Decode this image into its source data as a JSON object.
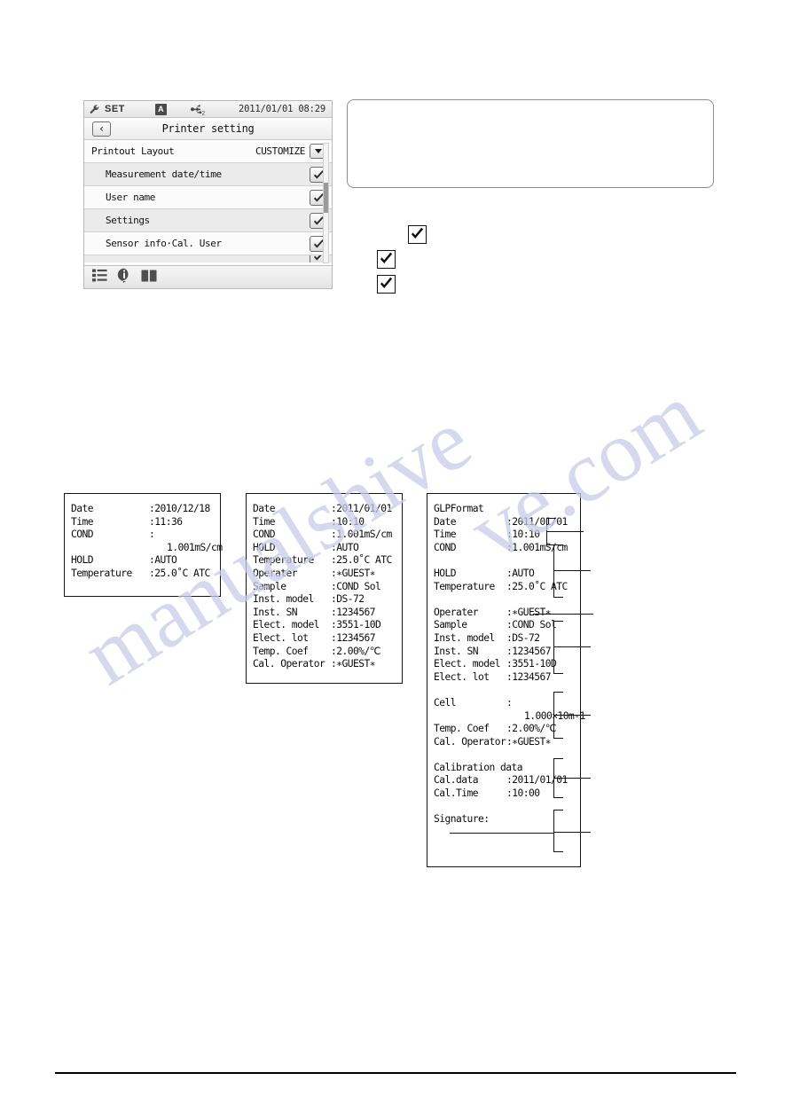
{
  "device": {
    "status_bar": {
      "mode_label": "SET",
      "wrench_icon": "wrench-icon",
      "a_badge": "A",
      "usb_icon": "usb-icon",
      "usb_subscript": "2",
      "datetime": "2011/01/01 08:29"
    },
    "title_bar": {
      "back_label": "‹",
      "title": "Printer setting"
    },
    "rows": [
      {
        "label": "Printout Layout",
        "value": "CUSTOMIZE",
        "control": "dropdown",
        "level": 0
      },
      {
        "label": "Measurement date/time",
        "value": "",
        "control": "checkbox",
        "checked": true,
        "level": 1
      },
      {
        "label": "User name",
        "value": "",
        "control": "checkbox",
        "checked": true,
        "level": 1
      },
      {
        "label": "Settings",
        "value": "",
        "control": "checkbox",
        "checked": true,
        "level": 1
      },
      {
        "label": "Sensor info·Cal. User",
        "value": "",
        "control": "checkbox",
        "checked": true,
        "level": 1
      }
    ],
    "toolbar": [
      {
        "icon": "list-icon"
      },
      {
        "icon": "info-icon"
      },
      {
        "icon": "book-icon"
      }
    ]
  },
  "callout": {
    "text": ""
  },
  "floating_checkboxes": [
    {
      "name": "checkmark-icon-1",
      "checked": true
    },
    {
      "name": "checkmark-icon-2",
      "checked": true
    },
    {
      "name": "checkmark-icon-3",
      "checked": true
    }
  ],
  "printouts": [
    {
      "id": "printout-standard",
      "lines": [
        {
          "key": "Date",
          "value": ":2010/12/18"
        },
        {
          "key": "Time",
          "value": ":11:36"
        },
        {
          "key": "COND",
          "value": ":"
        },
        {
          "key": "",
          "value": "1.001mS/cm",
          "indent": true
        },
        {
          "key": "HOLD",
          "value": ":AUTO"
        },
        {
          "key": "Temperature",
          "value": ":25.0˚C ATC"
        }
      ]
    },
    {
      "id": "printout-customize",
      "lines": [
        {
          "key": "Date",
          "value": ":2011/01/01"
        },
        {
          "key": "Time",
          "value": ":10:10"
        },
        {
          "key": "COND",
          "value": ":1.001mS/cm"
        },
        {
          "key": "HOLD",
          "value": ":AUTO"
        },
        {
          "key": "Temperature",
          "value": ":25.0˚C ATC"
        },
        {
          "key": "Operater",
          "value": ":∗GUEST∗"
        },
        {
          "key": "Sample",
          "value": ":COND Sol"
        },
        {
          "key": "Inst. model",
          "value": ":DS-72"
        },
        {
          "key": "Inst. SN",
          "value": ":1234567"
        },
        {
          "key": "Elect. model",
          "value": ":3551-10D"
        },
        {
          "key": "Elect. lot",
          "value": ":1234567"
        },
        {
          "key": "Temp. Coef",
          "value": ":2.00%/℃"
        },
        {
          "key": "Cal. Operator",
          "value": ":∗GUEST∗"
        }
      ]
    },
    {
      "id": "printout-glp",
      "lines": [
        {
          "key": "GLPFormat",
          "value": "",
          "full": true
        },
        {
          "key": "Date",
          "value": ":2011/01/01"
        },
        {
          "key": "Time",
          "value": ":10:10"
        },
        {
          "key": "COND",
          "value": ":1.001mS/cm"
        },
        {
          "key": "",
          "value": "",
          "blank": true
        },
        {
          "key": "HOLD",
          "value": ":AUTO"
        },
        {
          "key": "Temperature",
          "value": ":25.0˚C ATC"
        },
        {
          "key": "",
          "value": "",
          "blank": true
        },
        {
          "key": "Operater",
          "value": ":∗GUEST∗"
        },
        {
          "key": "Sample",
          "value": ":COND Sol"
        },
        {
          "key": "Inst. model",
          "value": ":DS-72"
        },
        {
          "key": "Inst. SN",
          "value": ":1234567"
        },
        {
          "key": "Elect. model",
          "value": ":3551-10D"
        },
        {
          "key": "Elect. lot",
          "value": ":1234567"
        },
        {
          "key": "",
          "value": "",
          "blank": true
        },
        {
          "key": "Cell",
          "value": ":"
        },
        {
          "key": "",
          "value": "1.000×10m-1",
          "indent": true
        },
        {
          "key": "Temp. Coef",
          "value": ":2.00%/℃"
        },
        {
          "key": "Cal. Operator",
          "value": ":∗GUEST∗"
        },
        {
          "key": "",
          "value": "",
          "blank": true
        },
        {
          "key": "Calibration data",
          "value": "",
          "full": true
        },
        {
          "key": "Cal.data",
          "value": ":2011/01/01"
        },
        {
          "key": "Cal.Time",
          "value": ":10:00"
        },
        {
          "key": "",
          "value": "",
          "blank": true
        },
        {
          "key": "Signature:",
          "value": "",
          "full": true
        }
      ]
    }
  ],
  "watermark": {
    "line_a": "manualshive",
    "line_b": "ve.com"
  }
}
